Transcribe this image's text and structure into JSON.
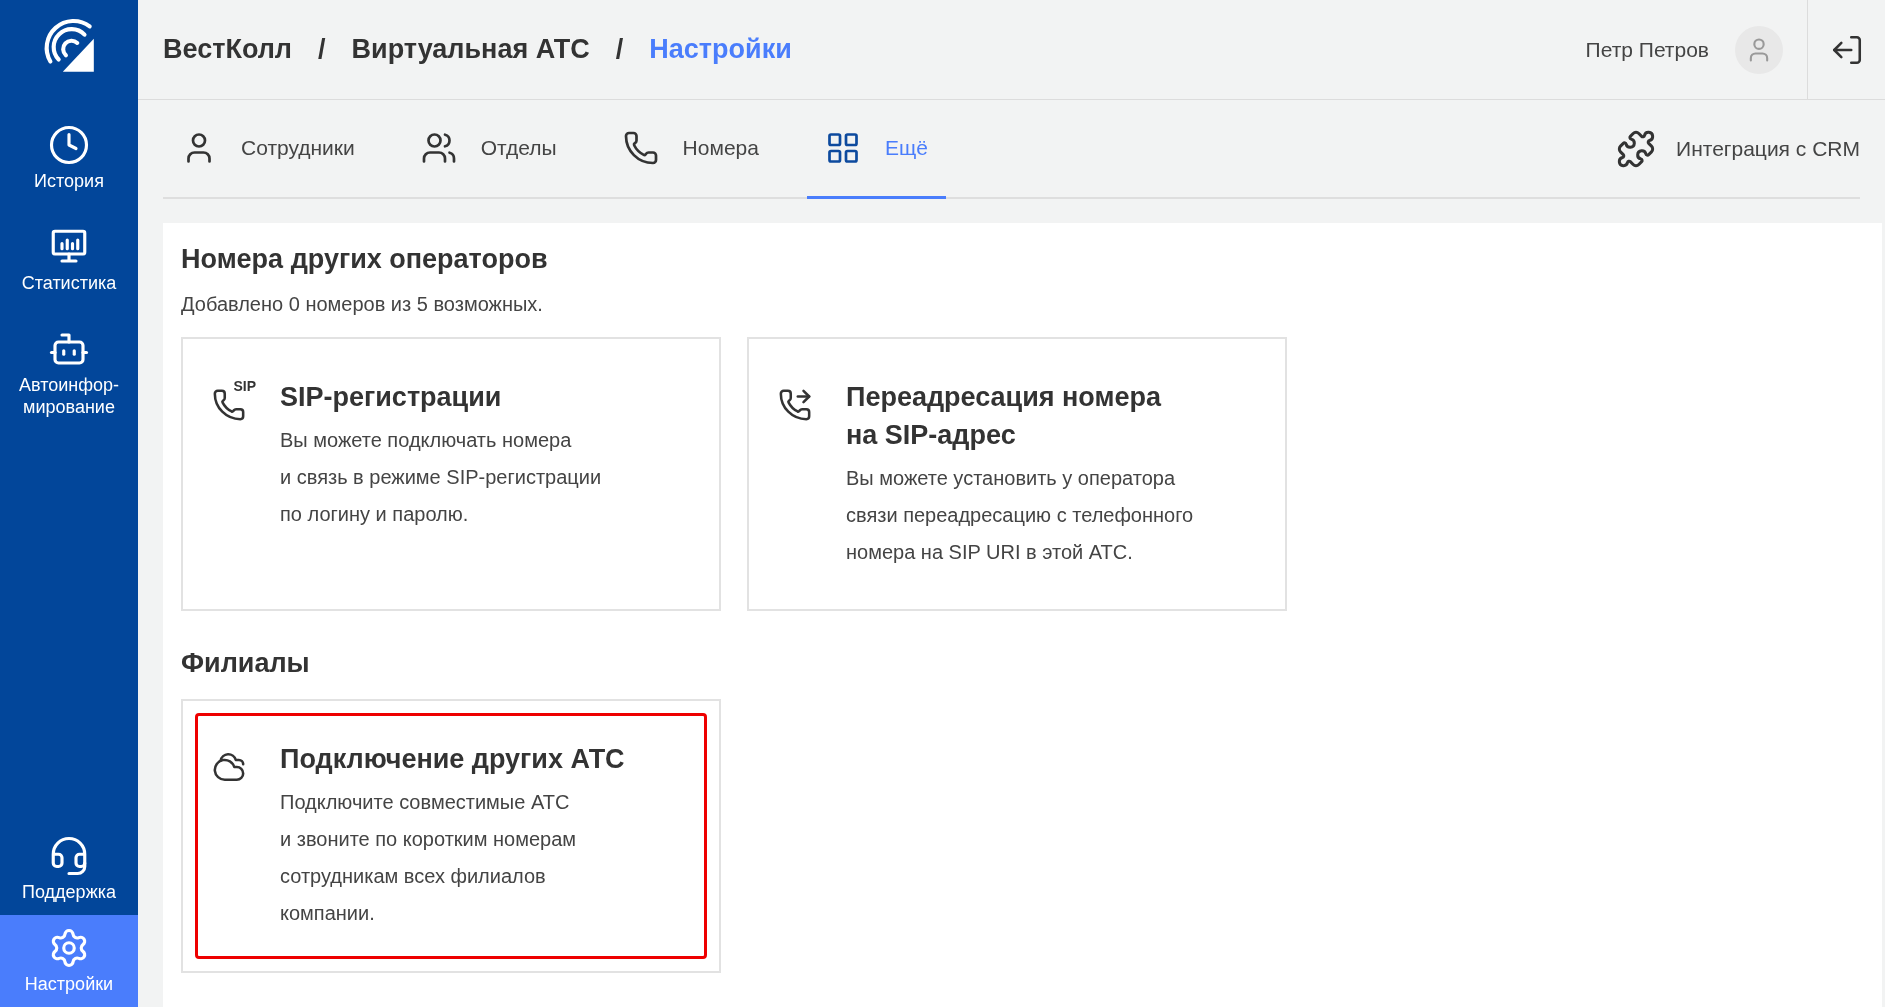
{
  "sidebar": {
    "items": [
      {
        "label": "История",
        "selected": false
      },
      {
        "label": "Статистика",
        "selected": false
      },
      {
        "label": "Автоинфор-\nмирование",
        "selected": false
      }
    ],
    "bottom_items": [
      {
        "label": "Поддержка",
        "selected": false
      },
      {
        "label": "Настройки",
        "selected": true
      }
    ]
  },
  "breadcrumb": [
    {
      "label": "ВестКолл",
      "current": false
    },
    {
      "label": "Виртуальная АТС",
      "current": false
    },
    {
      "label": "Настройки",
      "current": true
    }
  ],
  "breadcrumb_separator": "/",
  "user": {
    "name": "Петр Петров"
  },
  "tabs": [
    {
      "label": "Сотрудники",
      "selected": false
    },
    {
      "label": "Отделы",
      "selected": false
    },
    {
      "label": "Номера",
      "selected": false
    },
    {
      "label": "Ещё",
      "selected": true
    }
  ],
  "crm_link": "Интеграция с CRM",
  "sections": [
    {
      "title": "Номера других операторов",
      "subtitle": "Добавлено 0 номеров из 5 возможных.",
      "cards": [
        {
          "icon_text": "SIP",
          "title": "SIP-регистрации",
          "description": "Вы можете подключать номера\nи связь в режиме SIP-регистрации\nпо логину и паролю.",
          "highlighted": false
        },
        {
          "title": "Переадресация номера\nна SIP-адрес",
          "description": "Вы можете установить у оператора\nсвязи переадресацию с телефонного\nномера на SIP URI в этой АТС.",
          "highlighted": false
        }
      ]
    },
    {
      "title": "Филиалы",
      "cards": [
        {
          "title": "Подключение других АТС",
          "description": "Подключите совместимые АТС\nи звоните по коротким номерам\nсотрудникам всех филиалов\nкомпании.",
          "highlighted": true
        }
      ]
    }
  ]
}
